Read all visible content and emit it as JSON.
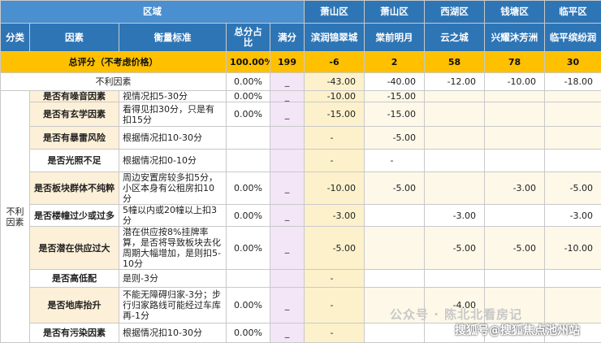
{
  "header": {
    "region_label": "区域",
    "columns": [
      "分类",
      "因素",
      "衡量标准",
      "总分占比",
      "满分"
    ],
    "districts": [
      "萧山区",
      "萧山区",
      "西湖区",
      "钱塘区",
      "临平区"
    ],
    "projects": [
      "滨润锦翠城",
      "棠前明月",
      "云之城",
      "兴耀沐芳洲",
      "临平缤纷润"
    ]
  },
  "total_row": {
    "label": "总评分（不考虑价格）",
    "pct": "100.00%",
    "full": "199",
    "scores": [
      "-6",
      "2",
      "58",
      "78",
      "30"
    ]
  },
  "adverse_row": {
    "label": "不利因素",
    "pct": "0.00%",
    "full": "_",
    "scores": [
      "-43.00",
      "-40.00",
      "-12.00",
      "-10.00",
      "-18.00"
    ]
  },
  "category_label": "不利因素",
  "rows": [
    {
      "factor": "是否有噪音因素",
      "criterion": "视情况扣5-30分",
      "pct": "0.00%",
      "full": "_",
      "scores": [
        "-10.00",
        "-15.00",
        "",
        "",
        ""
      ]
    },
    {
      "factor": "是否有玄学因素",
      "criterion": "看得见扣30分，只是有扣15分",
      "pct": "0.00%",
      "full": "_",
      "scores": [
        "-15.00",
        "-15.00",
        "",
        "",
        ""
      ]
    },
    {
      "factor": "是否有暴雷风险",
      "criterion": "根据情况扣10-30分",
      "pct": "",
      "full": "",
      "scores": [
        "-",
        "-5.00",
        "",
        "",
        ""
      ]
    },
    {
      "factor": "是否光照不足",
      "criterion": "根据情况扣0-10分",
      "pct": "",
      "full": "",
      "scores": [
        "-",
        "-",
        "",
        "",
        ""
      ]
    },
    {
      "factor": "是否板块群体不纯粹",
      "criterion": "周边安置房较多扣5分，小区本身有公租房扣10分",
      "pct": "0.00%",
      "full": "_",
      "scores": [
        "-10.00",
        "-5.00",
        "",
        "-3.00",
        "-5.00"
      ]
    },
    {
      "factor": "是否楼幢过少或过多",
      "criterion": "5幢以内或20幢以上扣3分",
      "pct": "0.00%",
      "full": "_",
      "scores": [
        "-3.00",
        "",
        "-3.00",
        "",
        "-3.00"
      ]
    },
    {
      "factor": "是否潜在供应过大",
      "criterion": "潜在供应按8%挂牌率算，是否将导致板块去化周期大幅增加，是则扣5-10分",
      "pct": "0.00%",
      "full": "_",
      "scores": [
        "-5.00",
        "",
        "-5.00",
        "-5.00",
        "-10.00"
      ]
    },
    {
      "factor": "是否高低配",
      "criterion": "是则-3分",
      "pct": "",
      "full": "",
      "scores": [
        "-",
        "",
        "",
        "",
        ""
      ]
    },
    {
      "factor": "是否地库抬升",
      "criterion": "不能无障碍归家-3分；步行归家路线可能经过车库再-1分",
      "pct": "0.00%",
      "full": "_",
      "scores": [
        "-",
        "",
        "-4.00",
        "",
        ""
      ]
    },
    {
      "factor": "是否有污染因素",
      "criterion": "根据情况扣10-30分",
      "pct": "0.00%",
      "full": "_",
      "scores": [
        "-",
        "",
        "",
        "",
        ""
      ]
    }
  ],
  "watermark": "公众号 · 陈北北看房记",
  "watermark2": "搜狐号@搜狐焦点池州站"
}
